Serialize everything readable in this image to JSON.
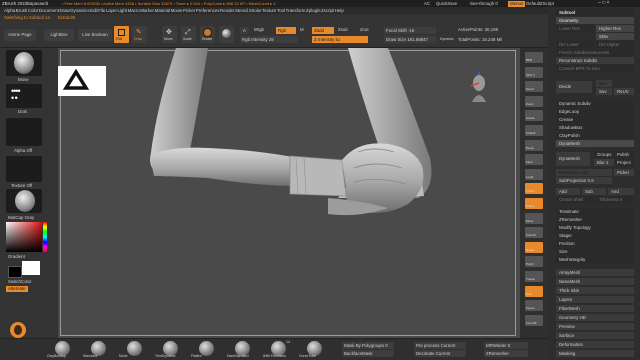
{
  "titlebar": {
    "app": "ZBrush 2022",
    "status": "• Free Mem 8.093GB • Active Mem 4328 • Scratch Disk 32679 • Timer ▸ 0.004 • PolyCount ▸ 868.13 KP • MeshCount ▸ 4",
    "ac": "AC",
    "quicksave": "QuickSave",
    "seethrough": "See-through  0",
    "menus_btn": "Menus",
    "script": "DefaultZScript",
    "doc_label": "Bapasaedt"
  },
  "menubar": [
    "Alpha",
    "Brush",
    "Color",
    "Document",
    "Draw",
    "Dynamics",
    "Edit",
    "File",
    "Layer",
    "Light",
    "Macro",
    "Marker",
    "Material",
    "Movie",
    "Picker",
    "Preferences",
    "Render",
    "Stencil",
    "Stroke",
    "Texture",
    "Tool",
    "Transform",
    "Zplugin",
    "Zscript",
    "Help"
  ],
  "topbar": {
    "switching": "Switching to Subtool 14",
    "extract": "Extract!0"
  },
  "toolbar": {
    "home": "Home Page",
    "lightbox": "LightBox",
    "livebool": "Live Boolean",
    "edit": "Edit",
    "draw": "Draw",
    "move": "Move",
    "scale": "Scale",
    "rotate": "Rotate",
    "a": "A",
    "mrgb": "Mrgb",
    "rgb": "Rgb",
    "m": "M",
    "zadd": "Zadd",
    "zsub": "Zsub",
    "zcut": "Zcut",
    "rgb_intensity": "Rgb Intensity 25",
    "z_intensity": "Z Intensity 51",
    "focal_shift": "Focal Shift -16",
    "draw_size": "Draw Size 181.68847",
    "dynamic": "Dynamic",
    "active_points": "ActivePoints: 30,198",
    "total_points": "TotalPoints: 18.248 Mil"
  },
  "lefttray": {
    "brush": "Move",
    "stroke": "Dots",
    "alpha": "Alpha Off",
    "texture": "Texture Off",
    "material": "MatCap Gray",
    "gradient": "Gradient",
    "switchcolor": "SwitchColor",
    "alternate": "Alternate"
  },
  "rshelf": [
    "BPR",
    "SPix 3",
    "Scroll",
    "Zoom",
    "Actual",
    "AAHalf",
    "Persp",
    "Floor",
    "Local",
    "L.Sym",
    "Frame",
    "Move",
    "ZoomD",
    "Rotate",
    "PolyF",
    "Transp",
    "Solo",
    "Xpose",
    "Line Fill"
  ],
  "rshelf_labels": {
    "local": "Local",
    "sym": "Sym",
    "gxyz": "Gxyz",
    "move": "Move",
    "zoom3d": "Zoom3D",
    "rotate": "Rotate",
    "ghost": "Ghost",
    "xpose": "Xpose",
    "linefill": "Line Fill"
  },
  "rtray": {
    "subtool": "Subtool",
    "geometry": "Geometry",
    "lower_res": "Lower Res",
    "higher_res": "Higher Res",
    "sdiv": "SDiv",
    "del_lower": "Del Lower",
    "del_higher": "Del Higher",
    "freeze": "Freeze SubdivisionLevels",
    "reconstruct": "Reconstruct Subdiv",
    "convert_bpr": "Convert BPR To Geo",
    "divide": "Divide",
    "smt": "Smt",
    "suv": "Suv",
    "reuv": "ReUV",
    "dynamic_subdiv": "Dynamic Subdiv",
    "edgeloop": "EdgeLoop",
    "crease": "Crease",
    "shadowbox": "ShadowBox",
    "claypolish": "ClayPolish",
    "dynamesh": "DynaMesh",
    "dynamesh_btn": "DynaMesh",
    "groups": "Groups",
    "polish": "Polish",
    "blur": "Blur 2",
    "project": "Project",
    "resolution": "Resolution 128",
    "picker": "Picker",
    "subprojection": "SubProjection 0.6",
    "add": "Add",
    "sub": "Sub",
    "and": "And",
    "create_shell": "Create Shell",
    "thickness": "Thickness 4",
    "tessimate": "Tessimate",
    "zremesher": "ZRemesher",
    "modify_topology": "Modify Topology",
    "stager": "Stager",
    "position": "Position",
    "size": "Size",
    "meshintegrity": "MeshIntegrity",
    "arraymesh": "ArrayMesh",
    "nanomesh": "NanoMesh",
    "thick_skin": "Thick Skin",
    "layers": "Layers",
    "fibermesh": "FiberMesh",
    "geometry_hd": "Geometry HD",
    "preview": "Preview",
    "surface": "Surface",
    "deformation": "Deformation",
    "masking": "Masking"
  },
  "bottom": {
    "brushes": [
      "ClayBuildup",
      "Standard",
      "Move",
      "TrimDynamic",
      "Flatten",
      "DamStandard",
      "IMM Primitives",
      "CurveTube"
    ],
    "imm_count": "14",
    "mask_by_polygroups": "Mask By Polygroups 0",
    "backface_mask": "BackfaceMask",
    "pre_process": "Pre process Current",
    "decimate": "Decimate Current",
    "mrwelder": "MRWelder 0",
    "zremesher": "ZRemesher"
  },
  "colors": {
    "accent": "#e8892a",
    "canvas": "#4a4a4a",
    "panel": "#2d2d2d"
  }
}
